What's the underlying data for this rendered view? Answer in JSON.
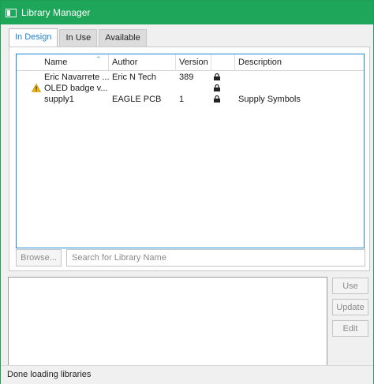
{
  "window": {
    "title": "Library Manager"
  },
  "tabs": [
    {
      "label": "In Design",
      "active": true
    },
    {
      "label": "In Use",
      "active": false
    },
    {
      "label": "Available",
      "active": false
    }
  ],
  "table": {
    "columns": [
      "Name",
      "Author",
      "Version",
      "",
      "Description"
    ],
    "rows": [
      {
        "name": "Eric Navarrete ...",
        "author": "Eric N Tech",
        "version": "389",
        "locked": true,
        "description": "",
        "warning": false
      },
      {
        "name": "OLED badge v...",
        "author": "",
        "version": "",
        "locked": true,
        "description": "",
        "warning": true
      },
      {
        "name": "supply1",
        "author": "EAGLE PCB",
        "version": "1",
        "locked": true,
        "description": "Supply Symbols",
        "warning": false
      }
    ]
  },
  "browse": {
    "label": "Browse..."
  },
  "search": {
    "placeholder": "Search for Library Name",
    "value": ""
  },
  "actions": {
    "use": "Use",
    "update": "Update",
    "edit": "Edit"
  },
  "status": {
    "text": "Done loading libraries"
  },
  "colors": {
    "titlebar": "#1ea65a",
    "accent": "#1e88d6",
    "warning": "#f2b705"
  }
}
